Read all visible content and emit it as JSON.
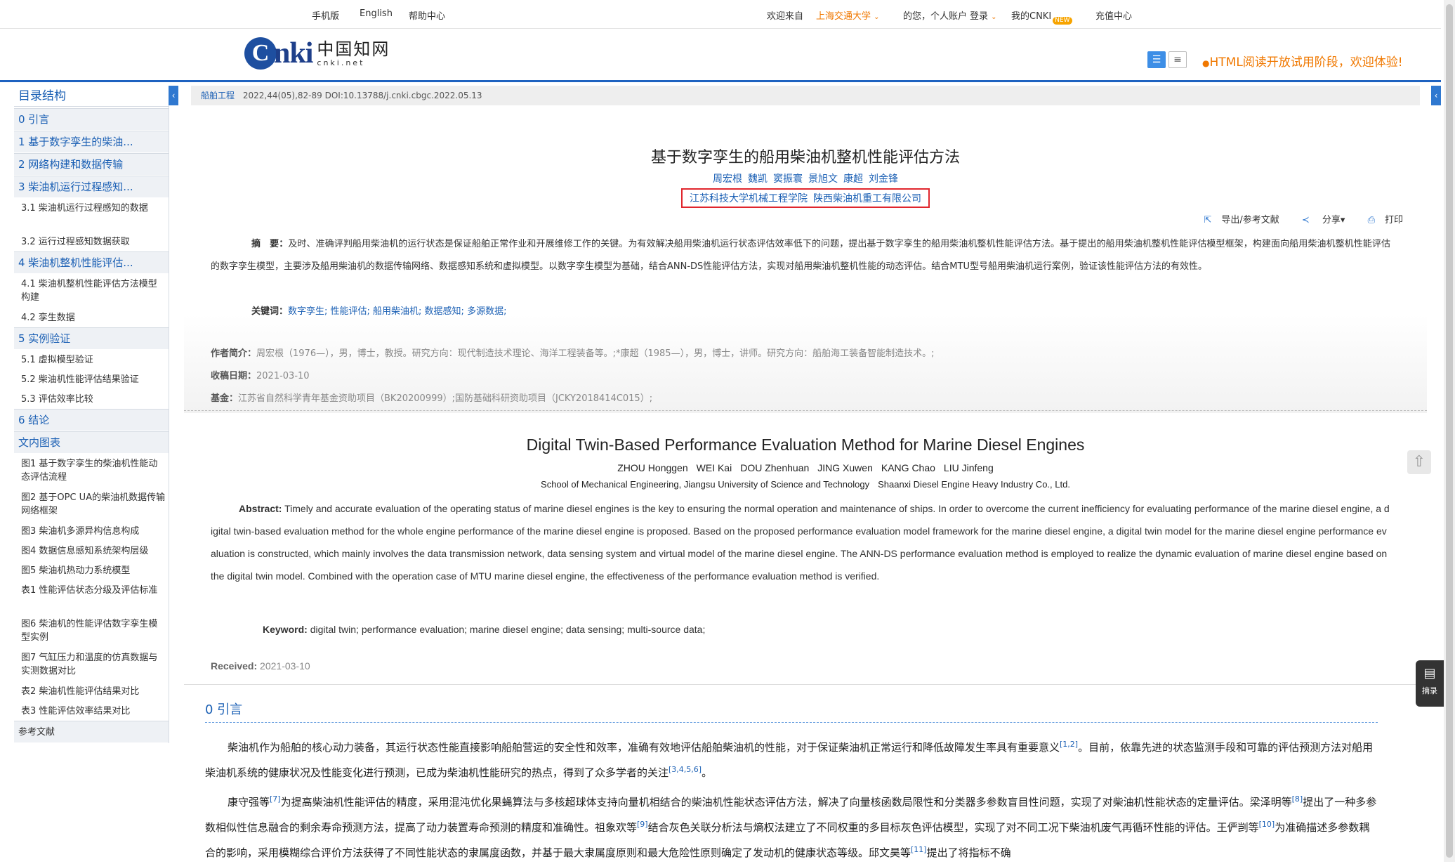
{
  "topbar": {
    "mobile": "手机版",
    "english": "English",
    "help": "帮助中心",
    "welcome": "欢迎来自",
    "institution": "上海交通大学",
    "greeting": "的您，个人账户",
    "login": "登录",
    "my_cnki": "我的CNKI",
    "new_badge": "NEW",
    "recharge": "充值中心"
  },
  "header": {
    "logo_c": "C",
    "logo_nki": "nki",
    "logo_cn": "中国知网",
    "logo_url": "cnki.net",
    "notice": "HTML阅读开放试用阶段，欢迎体验!"
  },
  "sidebar": {
    "title": "目录结构",
    "items": [
      {
        "label": "0 引言",
        "type": "sec"
      },
      {
        "label": "1 基于数字孪生的柴油...",
        "type": "sec"
      },
      {
        "label": "2 网络构建和数据传输",
        "type": "sec"
      },
      {
        "label": "3 柴油机运行过程感知...",
        "type": "sec"
      },
      {
        "label": "3.1 柴油机运行过程感知的数据",
        "type": "sub"
      },
      {
        "label": "3.2 运行过程感知数据获取",
        "type": "sub"
      },
      {
        "label": "4 柴油机整机性能评估...",
        "type": "sec"
      },
      {
        "label": "4.1 柴油机整机性能评估方法模型构建",
        "type": "sub"
      },
      {
        "label": "4.2 孪生数据",
        "type": "sub"
      },
      {
        "label": "5 实例验证",
        "type": "sec"
      },
      {
        "label": "5.1 虚拟模型验证",
        "type": "sub"
      },
      {
        "label": "5.2 柴油机性能评估结果验证",
        "type": "sub"
      },
      {
        "label": "5.3 评估效率比较",
        "type": "sub"
      },
      {
        "label": "6 结论",
        "type": "sec"
      },
      {
        "label": "文内图表",
        "type": "sec"
      },
      {
        "label": "图1 基于数字孪生的柴油机性能动态评估流程",
        "type": "sub"
      },
      {
        "label": "图2 基于OPC UA的柴油机数据传输网络框架",
        "type": "sub"
      },
      {
        "label": "图3 柴油机多源异构信息构成",
        "type": "sub"
      },
      {
        "label": "图4 数据信息感知系统架构层级",
        "type": "sub"
      },
      {
        "label": "图5 柴油机热动力系统模型",
        "type": "sub"
      },
      {
        "label": "表1 性能评估状态分级及评估标准",
        "type": "sub"
      },
      {
        "label": "图6 柴油机的性能评估数字孪生模型实例",
        "type": "sub"
      },
      {
        "label": "图7 气缸压力和温度的仿真数据与实测数据对比",
        "type": "sub"
      },
      {
        "label": "表2 柴油机性能评估结果对比",
        "type": "sub"
      },
      {
        "label": "表3 性能评估效率结果对比",
        "type": "sub"
      },
      {
        "label": "参考文献",
        "type": "sec"
      }
    ]
  },
  "article": {
    "journal": "船舶工程",
    "citation": "2022,44(05),82-89 DOI:10.13788/j.cnki.cbgc.2022.05.13",
    "title_zh": "基于数字孪生的船用柴油机整机性能评估方法",
    "authors_zh": [
      "周宏根",
      "魏凯",
      "窦振寰",
      "景旭文",
      "康超",
      "刘金锋"
    ],
    "orgs_zh": [
      "江苏科技大学机械工程学院",
      "陕西柴油机重工有限公司"
    ],
    "tools": {
      "export": "导出/参考文献",
      "share": "分享",
      "print": "打印"
    },
    "abstract_label": "摘　要：",
    "abstract_zh": "及时、准确评判船用柴油机的运行状态是保证船舶正常作业和开展维修工作的关键。为有效解决船用柴油机运行状态评估效率低下的问题，提出基于数字孪生的船用柴油机整机性能评估方法。基于提出的船用柴油机整机性能评估模型框架，构建面向船用柴油机整机性能评估的数字孪生模型，主要涉及船用柴油机的数据传输网络、数据感知系统和虚拟模型。以数字孪生模型为基础，结合ANN-DS性能评估方法，实现对船用柴油机整机性能的动态评估。结合MTU型号船用柴油机运行案例，验证该性能评估方法的有效性。",
    "keywords_label": "关键词：",
    "keywords_zh": "数字孪生; 性能评估; 船用柴油机; 数据感知; 多源数据;",
    "author_bio_label": "作者简介：",
    "author_bio": "周宏根（1976—），男，博士，教授。研究方向：现代制造技术理论、海洋工程装备等。;*康超（1985—），男，博士，讲师。研究方向：船舶海工装备智能制造技术。;",
    "received_label": "收稿日期：",
    "received": "2021-03-10",
    "fund_label": "基金：",
    "fund": "江苏省自然科学青年基金资助项目（BK20200999）;国防基础科研资助项目（JCKY2018414C015）;",
    "title_en": "Digital Twin-Based Performance Evaluation Method for Marine Diesel Engines",
    "authors_en": [
      "ZHOU Honggen",
      "WEI Kai",
      "DOU Zhenhuan",
      "JING Xuwen",
      "KANG Chao",
      "LIU Jinfeng"
    ],
    "orgs_en": [
      "School of Mechanical Engineering, Jiangsu University of Science and Technology",
      "Shaanxi Diesel Engine Heavy Industry Co., Ltd."
    ],
    "abstract_en_label": "Abstract:",
    "abstract_en": "Timely and accurate evaluation of the operating status of marine diesel engines is the key to ensuring the normal operation and maintenance of ships. In order to overcome the current inefficiency for evaluating performance of the marine diesel engine, a digital twin-based evaluation method for the whole engine performance of the marine diesel engine is proposed. Based on the proposed performance evaluation model framework for the marine diesel engine, a digital twin model for the marine diesel engine performance evaluation is constructed, which mainly involves the data transmission network, data sensing system and virtual model of the marine diesel engine. The ANN-DS performance evaluation method is employed to realize the dynamic evaluation of marine diesel engine based on the digital twin model. Combined with the operation case of MTU marine diesel engine, the effectiveness of the performance evaluation method is verified.",
    "keyword_en_label": "Keyword:",
    "keywords_en": "digital twin; performance evaluation; marine diesel engine; data sensing; multi-source data;",
    "received_en_label": "Received:",
    "received_en": "2021-03-10",
    "section0": "0 引言",
    "p1a": "柴油机作为船舶的核心动力装备，其运行状态性能直接影响船舶营运的安全性和效率，准确有效地评估船舶柴油机的性能，对于保证柴油机正常运行和降低故障发生率具有重要意义",
    "p1ref1": "[1,2]",
    "p1b": "。目前，依靠先进的状态监测手段和可靠的评估预测方法对船用柴油机系统的健康状况及性能变化进行预测，已成为柴油机性能研究的热点，得到了众多学者的关注",
    "p1ref2": "[3,4,5,6]",
    "p1c": "。",
    "p2a": "康守强等",
    "p2ref1": "[7]",
    "p2b": "为提高柴油机性能评估的精度，采用混沌优化果蝇算法与多核超球体支持向量机相结合的柴油机性能状态评估方法，解决了向量核函数局限性和分类器多参数盲目性问题，实现了对柴油机性能状态的定量评估。梁泽明等",
    "p2ref2": "[8]",
    "p2c": "提出了一种多参数相似性信息融合的剩余寿命预测方法，提高了动力装置寿命预测的精度和准确性。祖象欢等",
    "p2ref3": "[9]",
    "p2d": "结合灰色关联分析法与熵权法建立了不同权重的多目标灰色评估模型，实现了对不同工况下柴油机废气再循环性能的评估。王俨剀等",
    "p2ref4": "[10]",
    "p2e": "为准确描述多参数耦合的影响，采用模糊综合评价方法获得了不同性能状态的隶属度函数，并基于最大隶属度原则和最大危险性原则确定了发动机的健康状态等级。邱文昊等",
    "p2ref5": "[11]",
    "p2f": "提出了将指标不确"
  },
  "float": {
    "summary": "摘录"
  }
}
